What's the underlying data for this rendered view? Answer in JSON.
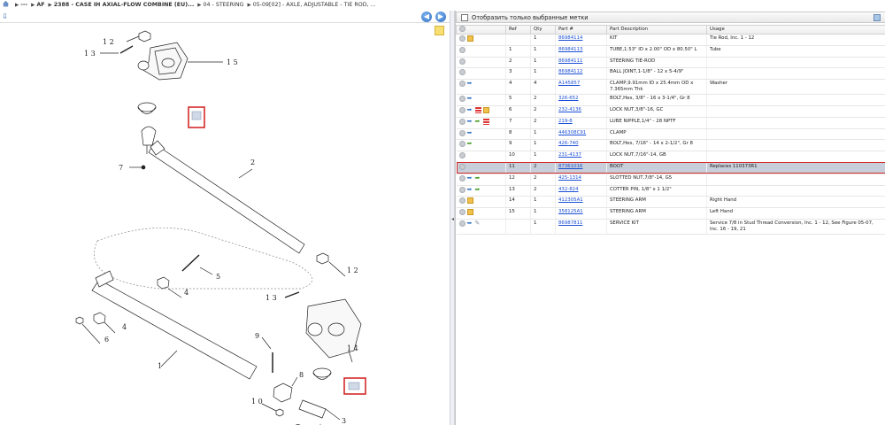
{
  "breadcrumb": {
    "items": [
      "---",
      "AF",
      "2388 - CASE IH AXIAL-FLOW COMBINE (EU)...",
      "04 - STEERING",
      "05-09[02] - AXLE, ADJUSTABLE - TIE ROD, ..."
    ]
  },
  "left_panel": {
    "nav_back_icon": "arrow-left-circle-icon",
    "nav_forward_icon": "arrow-right-circle-icon",
    "callouts": [
      "1 2",
      "1 3",
      "1 5",
      "2",
      "7",
      "5",
      "4",
      "4",
      "6",
      "1",
      "1 2",
      "1 3",
      "1 4",
      "9",
      "8",
      "1 0",
      "3",
      "7"
    ]
  },
  "right_panel": {
    "filter_label": "Отобразить только выбранные метки",
    "columns": [
      "",
      "Ref",
      "Qty",
      "Part #",
      "Part Description",
      "Usage"
    ],
    "rows": [
      {
        "icons": [
          "box"
        ],
        "ref": "",
        "qty": "1",
        "part": "86984114",
        "desc": "KIT",
        "usage": "Tie Rod, Inc. 1 - 12"
      },
      {
        "icons": [],
        "ref": "1",
        "qty": "1",
        "part": "86984113",
        "desc": "TUBE,1.53\" ID x 2.00\" OD x 80.50\" L",
        "usage": "Tube"
      },
      {
        "icons": [],
        "ref": "2",
        "qty": "1",
        "part": "86984111",
        "desc": "STEERING TIE-ROD",
        "usage": ""
      },
      {
        "icons": [],
        "ref": "3",
        "qty": "1",
        "part": "86984112",
        "desc": "BALL JOINT,1-1/8\" - 12 x 5-4/9\"",
        "usage": ""
      },
      {
        "icons": [
          "blue"
        ],
        "ref": "4",
        "qty": "4",
        "part": "A145857",
        "desc": "CLAMP,9.91mm ID x 25.4mm OD x 7.365mm Thk",
        "usage": "Washer"
      },
      {
        "icons": [
          "blue"
        ],
        "ref": "5",
        "qty": "2",
        "part": "326-652",
        "desc": "BOLT,Hex, 3/8\" - 16 x 3-1/4\", Gr 8",
        "usage": ""
      },
      {
        "icons": [
          "blue",
          "red",
          "box"
        ],
        "ref": "6",
        "qty": "2",
        "part": "232-4136",
        "desc": "LOCK NUT,3/8\"-16, GC",
        "usage": ""
      },
      {
        "icons": [
          "blue",
          "green",
          "red"
        ],
        "ref": "7",
        "qty": "2",
        "part": "219-8",
        "desc": "LUBE NIPPLE,1/4\" - 28 NPTF",
        "usage": ""
      },
      {
        "icons": [
          "blue"
        ],
        "ref": "8",
        "qty": "1",
        "part": "446308C91",
        "desc": "CLAMP",
        "usage": ""
      },
      {
        "icons": [
          "green"
        ],
        "ref": "9",
        "qty": "1",
        "part": "426-740",
        "desc": "BOLT,Hex, 7/16\" - 14 x 2-1/2\", Gr 8",
        "usage": ""
      },
      {
        "icons": [],
        "ref": "10",
        "qty": "1",
        "part": "231-4137",
        "desc": "LOCK NUT,7/16\"-14, GB",
        "usage": ""
      },
      {
        "icons": [],
        "ref": "11",
        "qty": "2",
        "part": "87361016",
        "desc": "BOOT",
        "usage": "Replaces 110373R1",
        "selected": true
      },
      {
        "icons": [
          "blue",
          "green"
        ],
        "ref": "12",
        "qty": "2",
        "part": "425-1314",
        "desc": "SLOTTED NUT,7/8\"-14, G5",
        "usage": ""
      },
      {
        "icons": [
          "blue",
          "green"
        ],
        "ref": "13",
        "qty": "2",
        "part": "432-824",
        "desc": "COTTER PIN, 1/8\" x 1 1/2\"",
        "usage": ""
      },
      {
        "icons": [
          "box"
        ],
        "ref": "14",
        "qty": "1",
        "part": "412305A1",
        "desc": "STEERING ARM",
        "usage": "Right Hand"
      },
      {
        "icons": [
          "box"
        ],
        "ref": "15",
        "qty": "1",
        "part": "358125A1",
        "desc": "STEERING ARM",
        "usage": "Left Hand"
      },
      {
        "icons": [
          "blue",
          "tool"
        ],
        "ref": "",
        "qty": "1",
        "part": "86987811",
        "desc": "SERVICE KIT",
        "usage": "Service 7/8 in Stud Thread Conversion, Inc. 1 - 12, See Figure 05-07, Inc. 16 - 19, 21"
      }
    ]
  }
}
